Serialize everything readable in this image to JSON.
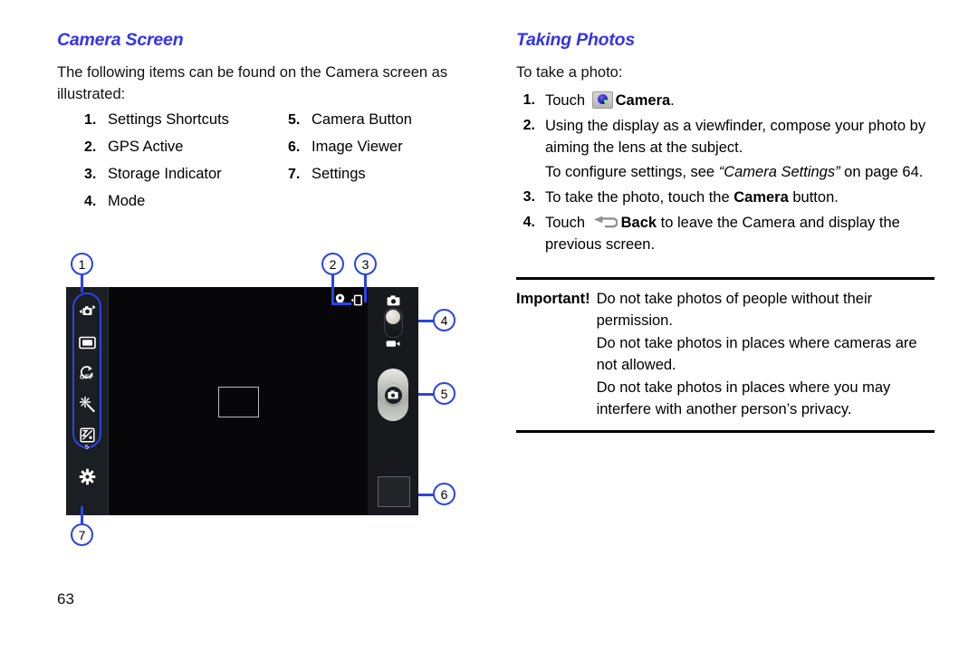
{
  "left_column": {
    "heading": "Camera Screen",
    "intro": "The following items can be found on the Camera screen as illustrated:",
    "items": [
      {
        "num": "1.",
        "label": "Settings Shortcuts"
      },
      {
        "num": "2.",
        "label": "GPS Active"
      },
      {
        "num": "3.",
        "label": "Storage Indicator"
      },
      {
        "num": "4.",
        "label": "Mode"
      },
      {
        "num": "5.",
        "label": "Camera Button"
      },
      {
        "num": "6.",
        "label": "Image Viewer"
      },
      {
        "num": "7.",
        "label": "Settings"
      }
    ]
  },
  "right_column": {
    "heading": "Taking Photos",
    "intro": "To take a photo:",
    "steps": [
      {
        "num": "1.",
        "prefix": "Touch ",
        "icon": "camera-app-icon",
        "bold": "Camera",
        "suffix": "."
      },
      {
        "num": "2.",
        "text": "Using the display as a viewfinder, compose your photo by aiming the lens at the subject.",
        "sub_prefix": "To configure settings, see ",
        "sub_italic": "“Camera Settings”",
        "sub_suffix": " on page 64."
      },
      {
        "num": "3.",
        "prefix": "To take the photo, touch the ",
        "bold": "Camera",
        "suffix": " button."
      },
      {
        "num": "4.",
        "prefix": "Touch ",
        "icon": "back-arrow-icon",
        "bold": "Back",
        "suffix": " to leave the Camera and display the previous screen."
      }
    ],
    "important": {
      "label": "Important!",
      "lines": [
        "Do not take photos of people without their permission.",
        "Do not take photos in places where cameras are not allowed.",
        "Do not take photos in places where you may interfere with another person’s privacy."
      ]
    }
  },
  "figure": {
    "callouts": [
      {
        "id": "1",
        "target": "settings-shortcuts"
      },
      {
        "id": "2",
        "target": "gps-active"
      },
      {
        "id": "3",
        "target": "storage-indicator"
      },
      {
        "id": "4",
        "target": "mode"
      },
      {
        "id": "5",
        "target": "camera-button"
      },
      {
        "id": "6",
        "target": "image-viewer"
      },
      {
        "id": "7",
        "target": "settings"
      }
    ],
    "toolbar_icons": [
      "switch-camera-icon",
      "screen-mode-icon",
      "timer-off-icon",
      "effects-icon",
      "exposure-icon",
      "settings-gear-icon"
    ],
    "exposure_value": "5",
    "timer_label": "OFF",
    "status_icons": [
      "gps-pin-icon",
      "storage-device-icon"
    ],
    "mode_icons": [
      "camera-mode-icon",
      "video-mode-icon"
    ],
    "accent_color": "#2a44e8",
    "heading_color": "#3333ee"
  },
  "page_number": "63"
}
